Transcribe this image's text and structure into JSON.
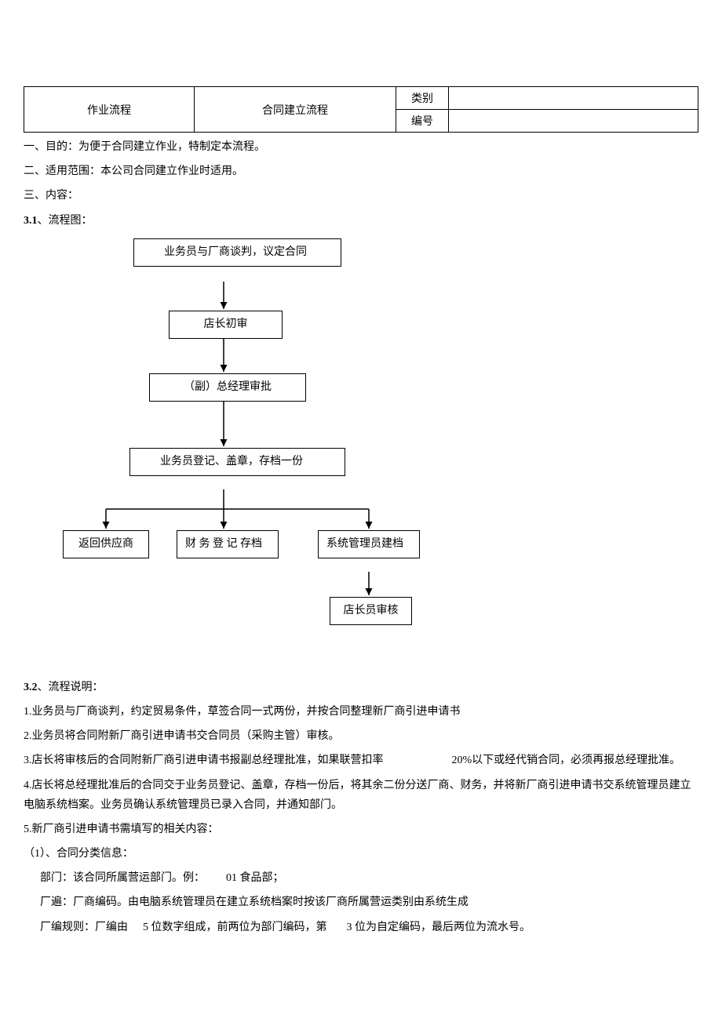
{
  "header": {
    "col1": "作业流程",
    "col2": "合同建立流程",
    "row1_label": "类别",
    "row1_value": "",
    "row2_label": "编号",
    "row2_value": ""
  },
  "intro": {
    "line1": "一、目的：为便于合同建立作业，特制定本流程。",
    "line2": "二、适用范围：本公司合同建立作业时适用。",
    "line3": "三、内容：",
    "section31_prefix": "3.1",
    "section31_suffix": "、流程图："
  },
  "flow": {
    "n1": "　　业务员与厂商谈判，议定合同",
    "n2": "店长初审",
    "n3": "（副）总经理审批",
    "n4": "　　业务员登记、盖章，存档一份",
    "n5": "返回供应商",
    "n6": "财 务 登 记 存档",
    "n7": "系统管理员建档",
    "n8": "店长员审核"
  },
  "explain": {
    "section32_prefix": "3.2",
    "section32_suffix": "、流程说明：",
    "p1": "1.业务员与厂商谈判，约定贸易条件，草签合同一式两份，并按合同整理新厂商引进申请书",
    "p2": "2.业务员将合同附新厂商引进申请书交合同员（采购主管）审核。",
    "p3a": "3.店长将审核后的合同附新厂商引进申请书报副总经理批准，如果联营扣率",
    "p3b": "20%以下或经代销合同，必须再报总经理批准。",
    "p4": "4.店长将总经理批准后的合同交于业务员登记、盖章，存档一份后，将其余二份分送厂商、财务，并将新厂商引进申请书交系统管理员建立电脑系统档案。业务员确认系统管理员已录入合同，并通知部门。",
    "p5": "5.新厂商引进申请书需填写的相关内容：",
    "p6": "（1）、合同分类信息：",
    "p7a": "部门：该合同所属营运部门。例：",
    "p7b": "01 食品部；",
    "p8": "厂遍：厂商编码。由电脑系统管理员在建立系统档案时按该厂商所属营运类别由系统生成",
    "p9a": "厂编规则：厂编由",
    "p9b": "5 位数字组成，前两位为部门编码，第",
    "p9c": "3 位为自定编码，最后两位为流水号。"
  }
}
